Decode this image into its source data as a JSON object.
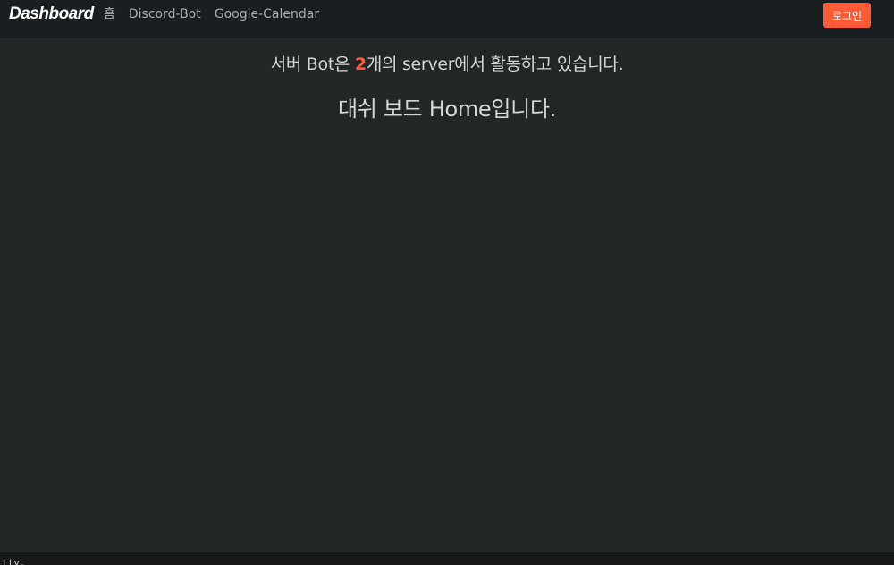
{
  "navbar": {
    "brand": "Dashboard",
    "links": [
      "홈",
      "Discord-Bot",
      "Google-Calendar"
    ],
    "login_label": "로그인"
  },
  "main": {
    "headline_prefix": "서버 Bot은 ",
    "server_count": "2",
    "headline_suffix": "개의 server에서 활동하고 있습니다.",
    "subheadline": "대쉬 보드 Home입니다."
  },
  "footer": {
    "text": "tty."
  },
  "colors": {
    "accent": "#ff5a36",
    "background": "#222627",
    "navbar": "#1b1e20"
  }
}
